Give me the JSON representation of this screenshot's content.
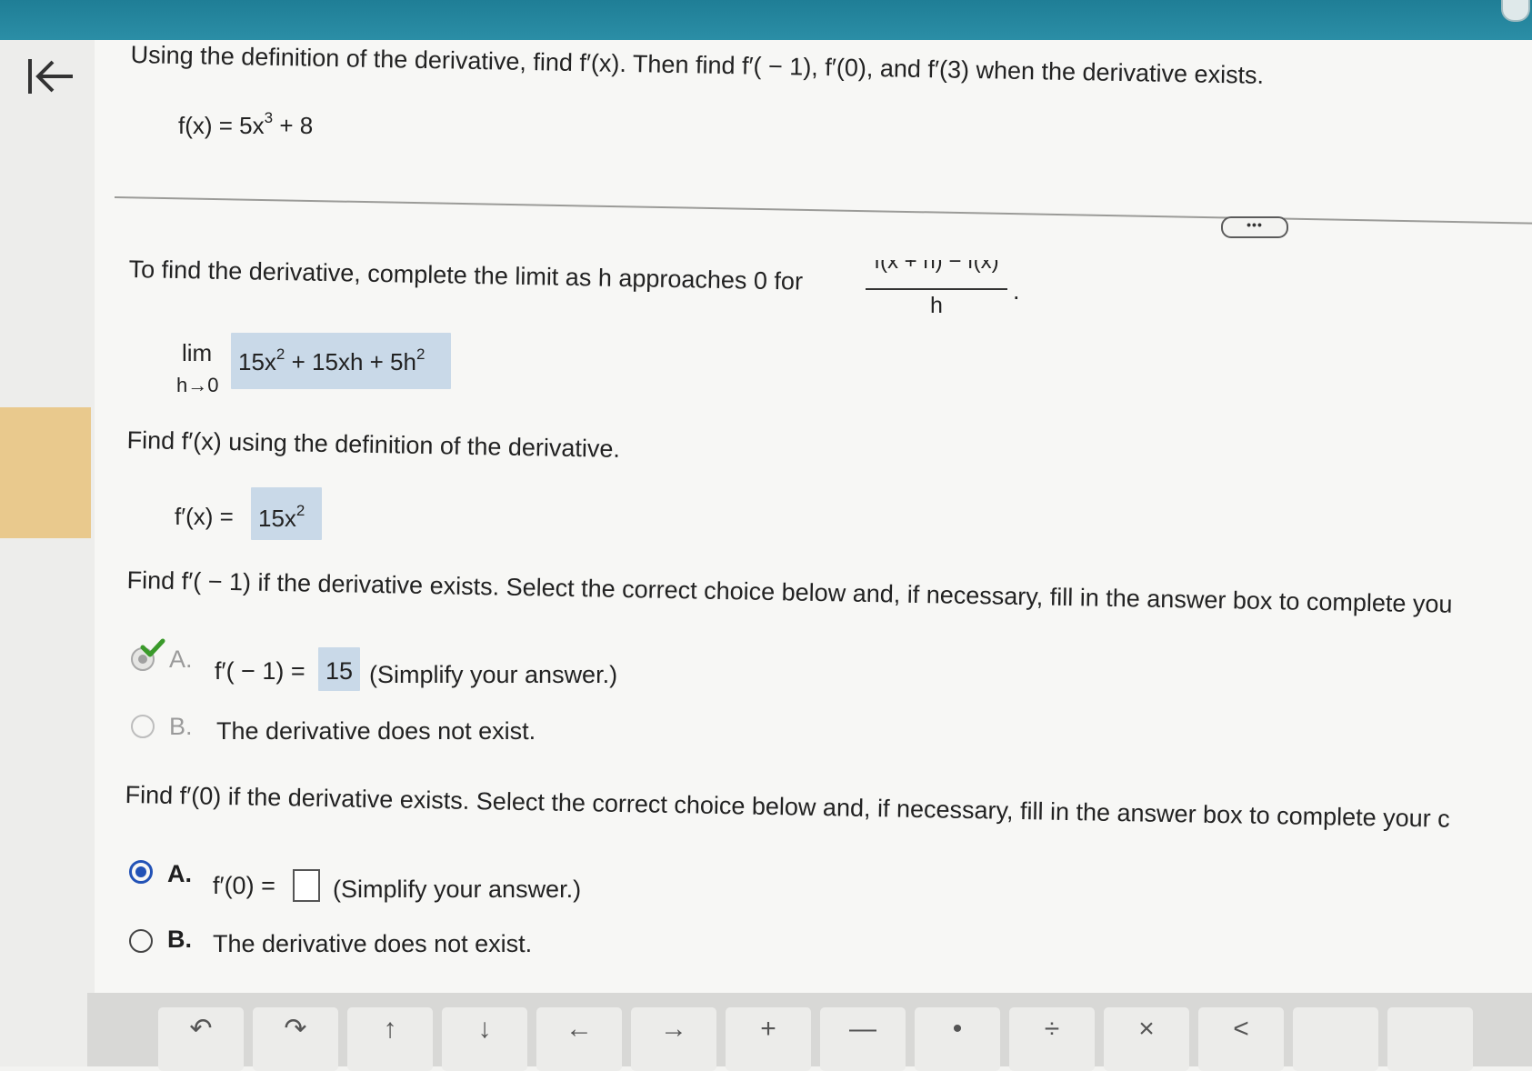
{
  "header": {
    "back_label": "|←"
  },
  "question": {
    "prompt": "Using the definition of the derivative, find f′(x). Then find f′( − 1), f′(0), and f′(3) when the derivative exists.",
    "function_lhs": "f(x) = 5x",
    "function_exp": "3",
    "function_rest": " + 8"
  },
  "more_label": "•••",
  "step1": {
    "prompt": "To find the derivative, complete the limit as h approaches 0 for",
    "frac_num": "f(x + h) − f(x)",
    "frac_den": "h",
    "period": ".",
    "lim": "lim",
    "lim_sub": "h→0",
    "answer_a": "15x",
    "answer_a_exp": "2",
    "answer_b": " + 15xh + 5h",
    "answer_b_exp": "2"
  },
  "step2": {
    "prompt": "Find f′(x) using the definition of the derivative.",
    "lhs": "f′(x) = ",
    "answer": "15x",
    "answer_exp": "2"
  },
  "step3": {
    "prompt": "Find f′( − 1) if the derivative exists. Select the correct choice below and, if necessary, fill in the answer box to complete you",
    "choice_a_letter": "A.",
    "choice_a_lhs": "f′( − 1) = ",
    "choice_a_value": "15",
    "choice_a_hint": "(Simplify your answer.)",
    "choice_b_letter": "B.",
    "choice_b_text": "The derivative does not exist."
  },
  "step4": {
    "prompt": "Find f′(0) if the derivative exists. Select the correct choice below and, if necessary, fill in the answer box to complete your c",
    "choice_a_letter": "A.",
    "choice_a_lhs": "f′(0) = ",
    "choice_a_value": "",
    "choice_a_hint": "(Simplify your answer.)",
    "choice_b_letter": "B.",
    "choice_b_text": "The derivative does not exist."
  },
  "toolbar": {
    "undo": "↶",
    "redo": "↷",
    "up": "↑",
    "down": "↓",
    "left": "←",
    "right": "→",
    "plus": "+",
    "minus": "—",
    "dot": "•",
    "divide": "÷",
    "times": "×",
    "less": "<"
  },
  "colors": {
    "topbar": "#2b8ea6",
    "selected": "#2252b6",
    "answer_highlight": "#c9d9e8",
    "check": "#3a9a2a",
    "side_strip": "#e9c98d"
  }
}
